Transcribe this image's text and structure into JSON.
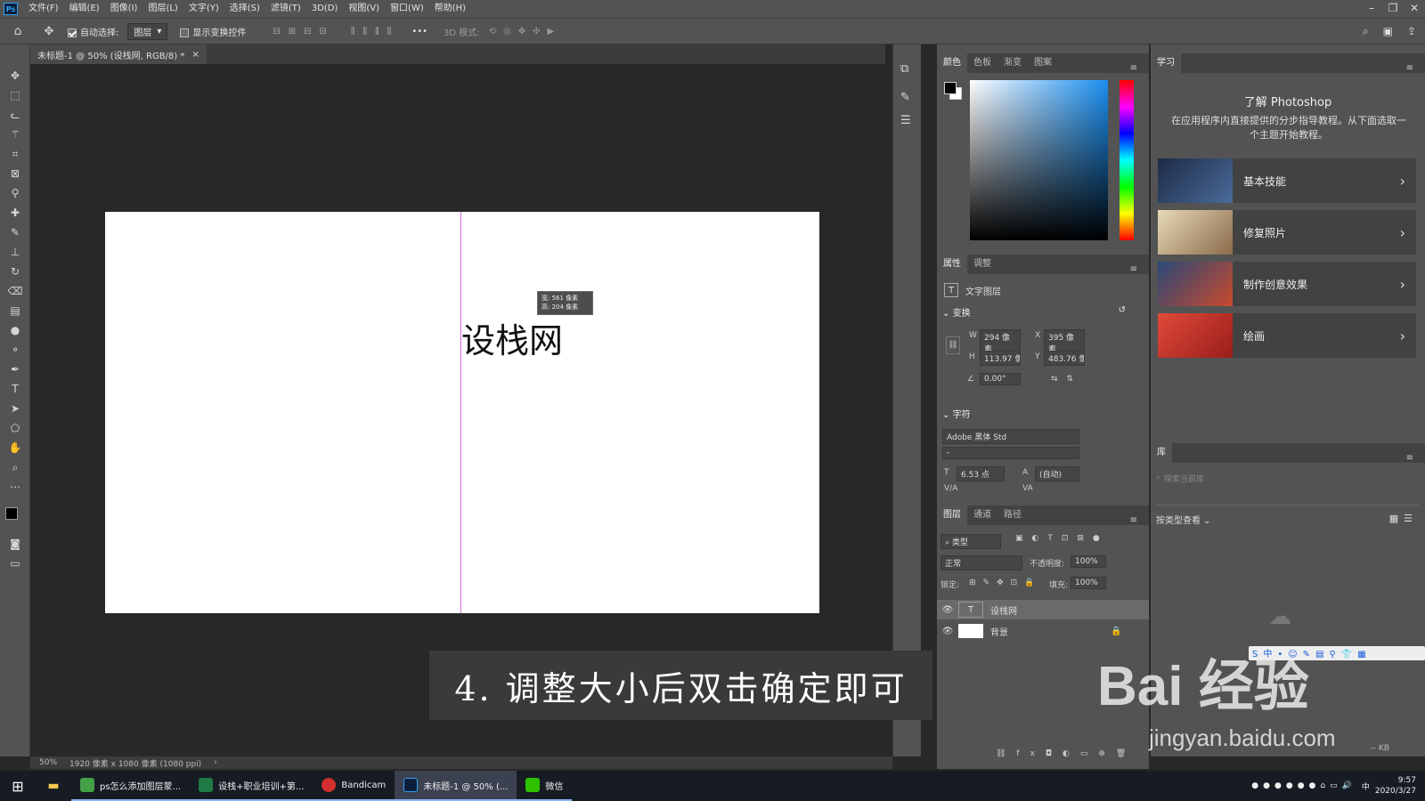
{
  "app": {
    "logo": "Ps"
  },
  "menu": [
    "文件(F)",
    "编辑(E)",
    "图像(I)",
    "图层(L)",
    "文字(Y)",
    "选择(S)",
    "滤镜(T)",
    "3D(D)",
    "视图(V)",
    "窗口(W)",
    "帮助(H)"
  ],
  "options": {
    "auto_select_label": "自动选择:",
    "auto_select_value": "图层",
    "show_transform_label": "显示变换控件",
    "mode_3d_label": "3D 模式:",
    "more": "•••"
  },
  "document": {
    "tab_title": "未标题-1 @ 50% (设栈网, RGB/8) *",
    "canvas_text": "设栈网",
    "tooltip_line1": "宽: 561 像素",
    "tooltip_line2": "高: 204 像素"
  },
  "status": {
    "zoom": "50%",
    "size": "1920 像素 x 1080 像素 (1080 ppi)"
  },
  "color_panel": {
    "tabs": [
      "颜色",
      "色板",
      "渐变",
      "图案"
    ],
    "foreground": "#000000",
    "background": "#ffffff",
    "accent": "#1a8ff0"
  },
  "properties": {
    "tabs": [
      "属性",
      "调整"
    ],
    "type_label": "文字图层",
    "transform_title": "变换",
    "w_label": "W",
    "w_value": "294 像素",
    "x_label": "X",
    "x_value": "395 像素",
    "h_label": "H",
    "h_value": "113.97 像素",
    "y_label": "Y",
    "y_value": "483.76 像素",
    "angle": "0.00°",
    "char_title": "字符",
    "font": "Adobe 黑体 Std",
    "font_style": "-",
    "size": "6.53 点",
    "leading": "(自动)",
    "va_label": "V/A",
    "va2_label": "VA"
  },
  "layers": {
    "tabs": [
      "图层",
      "通道",
      "路径"
    ],
    "filter": "类型",
    "blend": "正常",
    "opacity_label": "不透明度:",
    "opacity": "100%",
    "lock_label": "锁定:",
    "fill_label": "填充:",
    "fill": "100%",
    "items": [
      {
        "name": "设栈网",
        "type": "text"
      },
      {
        "name": "背景",
        "type": "image"
      }
    ]
  },
  "learn": {
    "tab": "学习",
    "title": "了解 Photoshop",
    "desc": "在应用程序内直接提供的分步指导教程。从下面选取一个主题开始教程。",
    "cards": [
      {
        "label": "基本技能",
        "color": "#2b3c5a"
      },
      {
        "label": "修复照片",
        "color": "#8a6b4a"
      },
      {
        "label": "制作创意效果",
        "color": "#3a5a8a"
      },
      {
        "label": "绘画",
        "color": "#c8342c"
      }
    ]
  },
  "library": {
    "tab": "库",
    "search_placeholder": "搜索当前库",
    "view_label": "按类型查看",
    "kb": "-- KB"
  },
  "caption": "4. 调整大小后双击确定即可",
  "watermark": {
    "brand": "Bai 经验",
    "url": "jingyan.baidu.com"
  },
  "taskbar": {
    "items": [
      {
        "label": "ps怎么添加图层蒙...",
        "color": "#43a047"
      },
      {
        "label": "设栈+职业培训+第...",
        "color": "#1e7b45"
      },
      {
        "label": "Bandicam",
        "color": "#d32f2f"
      },
      {
        "label": "未标题-1 @ 50% (...",
        "color": "#0b1f3a"
      },
      {
        "label": "微信",
        "color": "#2dc100"
      }
    ],
    "time": "9:57",
    "date": "2020/3/27",
    "ime": "中"
  }
}
